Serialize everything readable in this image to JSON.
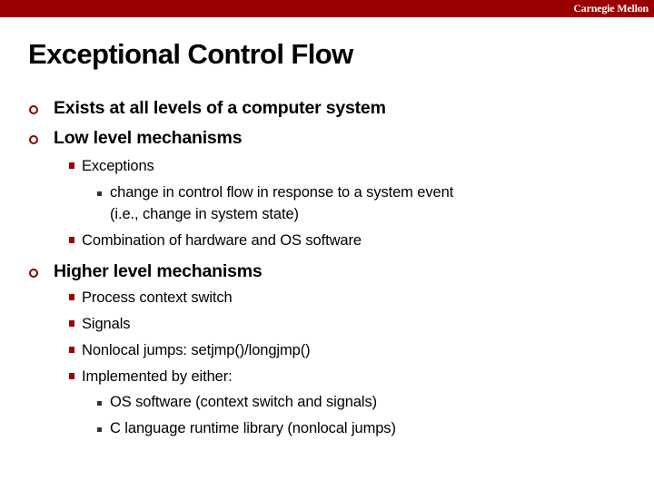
{
  "header": {
    "brand": "Carnegie Mellon",
    "accent_color": "#990000"
  },
  "slide": {
    "title": "Exceptional Control Flow",
    "bullets": [
      {
        "text": "Exists at all levels of a computer system"
      },
      {
        "text": "Low level mechanisms",
        "sub": [
          {
            "text": "Exceptions",
            "sub": [
              {
                "text": "change in control flow in response to a system event",
                "continuation": "(i.e.,  change in system state)"
              }
            ]
          },
          {
            "text": "Combination of hardware and OS software"
          }
        ]
      },
      {
        "text": "Higher level mechanisms",
        "sub": [
          {
            "text": "Process context switch"
          },
          {
            "text": "Signals"
          },
          {
            "text": "Nonlocal jumps: setjmp()/longjmp()"
          },
          {
            "text": "Implemented by either:",
            "sub": [
              {
                "text": "OS software (context switch and signals)"
              },
              {
                "text": "C language runtime library (nonlocal jumps)"
              }
            ]
          }
        ]
      }
    ]
  }
}
